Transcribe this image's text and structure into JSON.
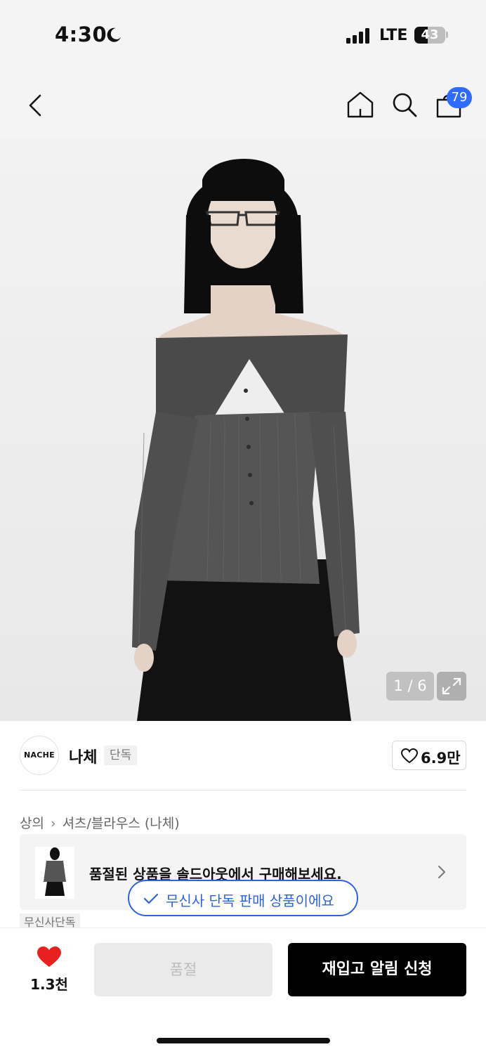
{
  "status_bar": {
    "time": "4:30",
    "network": "LTE",
    "battery_level": "43",
    "battery_fraction": 0.43
  },
  "header": {
    "cart_count": "79",
    "icons": [
      "back-icon",
      "home-icon",
      "search-icon",
      "cart-icon"
    ]
  },
  "gallery": {
    "counter": "1 / 6",
    "current_image": 1,
    "total_images": 6
  },
  "brand": {
    "logo_text": "NACHE",
    "name": "나체",
    "tag": "단독",
    "like_count": "6.9만"
  },
  "category": {
    "level1": "상의",
    "level2": "셔츠/블라우스 (나체)"
  },
  "soldout_banner": {
    "text": "품절된 상품을 솔드아웃에서 구매해보세요."
  },
  "exclusive_pill": {
    "text": "무신사 단독 판매 상품이에요"
  },
  "exclusive_label": "무신사단독",
  "bottom_bar": {
    "wish_count": "1.3천",
    "soldout_label": "품절",
    "restock_label": "재입고 알림 신청"
  },
  "colors": {
    "accent_blue": "#2f62e0",
    "badge_blue": "#2f6bff",
    "heart_red": "#e8201f",
    "primary_button": "#000000"
  }
}
